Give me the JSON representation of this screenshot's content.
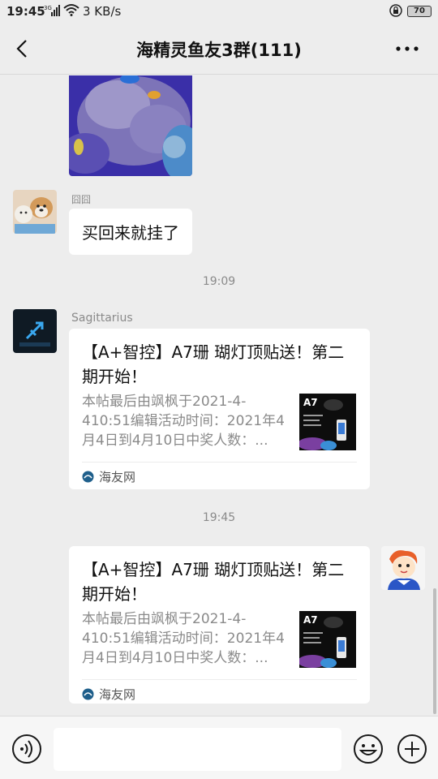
{
  "status_bar": {
    "time": "19:45",
    "signal": "3G",
    "speed": "3 KB/s",
    "battery": "70"
  },
  "nav": {
    "title": "海精灵鱼友3群(111)"
  },
  "messages": [
    {
      "type": "image",
      "alt": "aquarium-rock-photo"
    },
    {
      "type": "text",
      "sender": "囧囧",
      "text": "买回来就挂了"
    },
    {
      "type": "timestamp",
      "text": "19:09"
    },
    {
      "type": "link-card",
      "sender": "Sagittarius",
      "title": "【A+智控】A7珊 瑚灯顶贴送！第二期开始！",
      "description": "本帖最后由飒枫于2021-4-410:51编辑活动时间：2021年4月4日到4月10日中奖人数：...",
      "thumb_text": "A7",
      "source": "海友网"
    },
    {
      "type": "timestamp",
      "text": "19:45"
    },
    {
      "type": "link-card",
      "sender": "",
      "title": "【A+智控】A7珊 瑚灯顶贴送！第二期开始！",
      "description": "本帖最后由飒枫于2021-4-410:51编辑活动时间：2021年4月4日到4月10日中奖人数：...",
      "thumb_text": "A7",
      "source": "海友网"
    }
  ],
  "input": {
    "placeholder": ""
  },
  "colors": {
    "background": "#ededed",
    "bubble": "#ffffff",
    "timestamp": "#8a8a8a"
  }
}
